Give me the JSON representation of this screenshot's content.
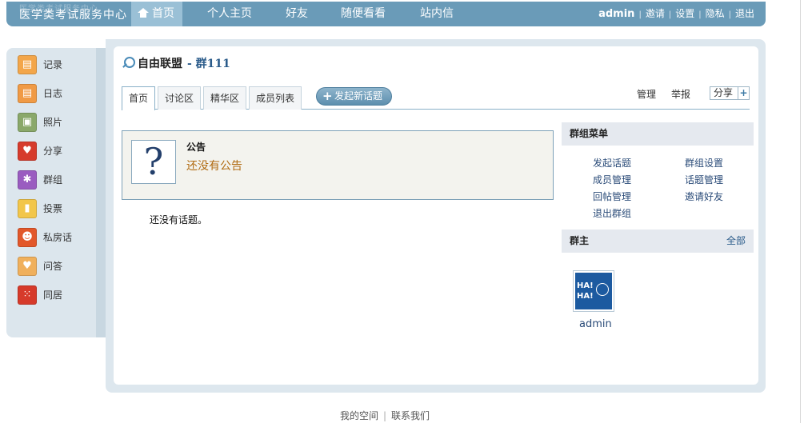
{
  "header": {
    "logo_text": "医学类考试服务中心",
    "logo_faint": "医学类考试服务中心",
    "nav": [
      "首页",
      "个人主页",
      "好友",
      "随便看看",
      "站内信"
    ],
    "username": "admin",
    "user_links": [
      "邀请",
      "设置",
      "隐私",
      "退出"
    ]
  },
  "sidebar": {
    "items": [
      {
        "label": "记录",
        "icon": "notepad-icon",
        "color": "#e98b2c"
      },
      {
        "label": "日志",
        "icon": "notebook-icon",
        "color": "#e87d2a"
      },
      {
        "label": "照片",
        "icon": "photo-icon",
        "color": "#6c8f4a"
      },
      {
        "label": "分享",
        "icon": "heart-icon",
        "color": "#d63b2c"
      },
      {
        "label": "群组",
        "icon": "group-icon",
        "color": "#8a4fb0"
      },
      {
        "label": "投票",
        "icon": "bar-chart-icon",
        "color": "#e0a321"
      },
      {
        "label": "私房话",
        "icon": "owl-icon",
        "color": "#e2572a"
      },
      {
        "label": "问答",
        "icon": "heart-card-icon",
        "color": "#e6a04c"
      },
      {
        "label": "同居",
        "icon": "dice-icon",
        "color": "#d63a2a"
      }
    ]
  },
  "group": {
    "name": "自由联盟",
    "subtitle": "- 群111"
  },
  "tabs": [
    "首页",
    "讨论区",
    "精华区",
    "成员列表"
  ],
  "new_topic_label": "发起新话题",
  "top_links": {
    "manage": "管理",
    "report": "举报",
    "share": "分享"
  },
  "announcement": {
    "title": "公告",
    "text": "还没有公告"
  },
  "no_topics": "还没有话题。",
  "group_menu": {
    "title": "群组菜单",
    "left": [
      "发起话题",
      "成员管理",
      "回帖管理",
      "退出群组"
    ],
    "right": [
      "群组设置",
      "话题管理",
      "邀请好友"
    ]
  },
  "owner": {
    "title": "群主",
    "all_label": "全部",
    "name": "admin",
    "avatar_text": "HA!\nHA!"
  },
  "footer": {
    "links": [
      "我的空间",
      "联系我们"
    ]
  }
}
